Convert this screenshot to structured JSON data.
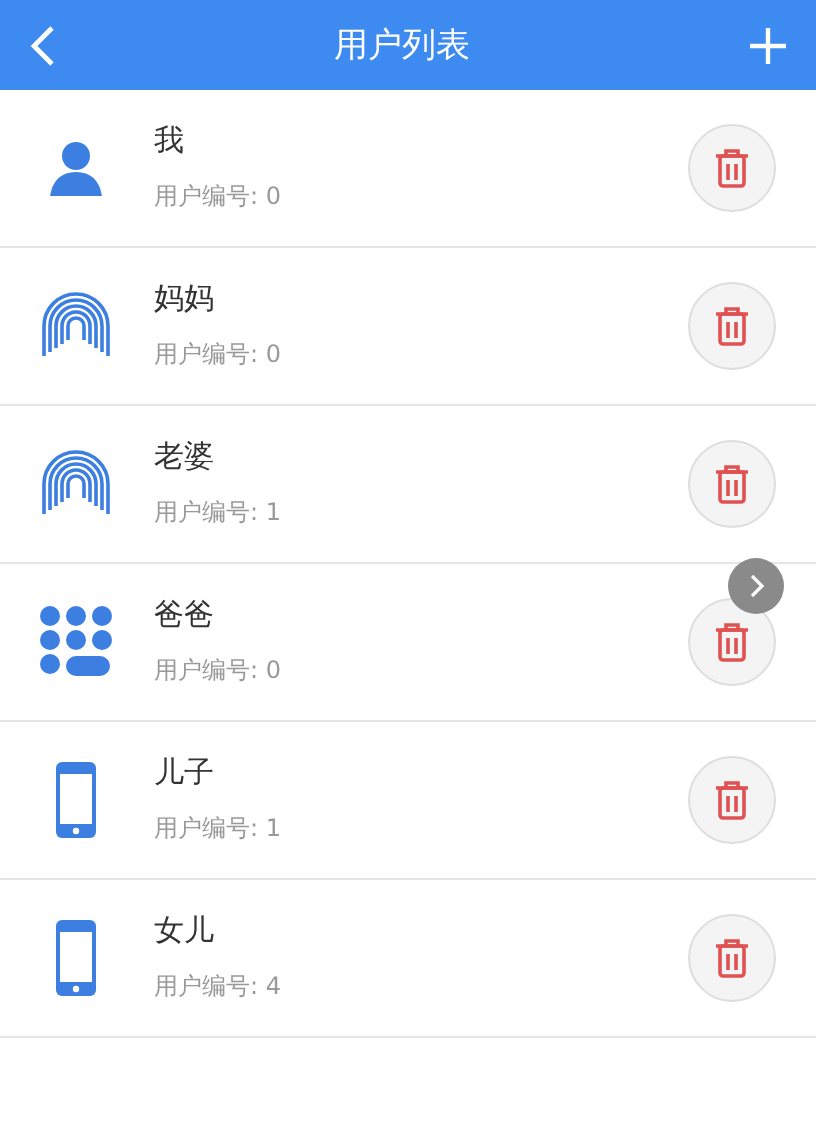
{
  "header": {
    "title": "用户列表"
  },
  "users": [
    {
      "kind": "person",
      "name": "我",
      "number": "用户编号: 0"
    },
    {
      "kind": "fingerprint",
      "name": "妈妈",
      "number": "用户编号: 0"
    },
    {
      "kind": "fingerprint",
      "name": "老婆",
      "number": "用户编号: 1"
    },
    {
      "kind": "keypad",
      "name": "爸爸",
      "number": "用户编号: 0"
    },
    {
      "kind": "phone",
      "name": "儿子",
      "number": "用户编号: 1"
    },
    {
      "kind": "phone",
      "name": "女儿",
      "number": "用户编号: 4"
    }
  ]
}
